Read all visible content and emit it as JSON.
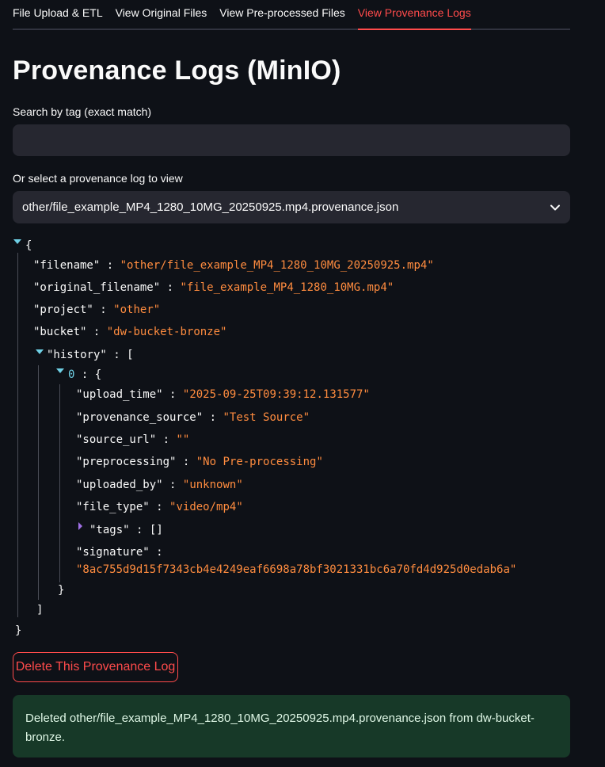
{
  "tabs": [
    {
      "label": "File Upload & ETL"
    },
    {
      "label": "View Original Files"
    },
    {
      "label": "View Pre-processed Files"
    },
    {
      "label": "View Provenance Logs"
    }
  ],
  "active_tab": "View Provenance Logs",
  "page_title": "Provenance Logs (MinIO)",
  "search": {
    "label": "Search by tag (exact match)",
    "value": "",
    "placeholder": ""
  },
  "select": {
    "label": "Or select a provenance log to view",
    "value": "other/file_example_MP4_1280_10MG_20250925.mp4.provenance.json"
  },
  "json_view": {
    "open_brace": "{",
    "close_brace": "}",
    "filename_key": "\"filename\"",
    "filename_val": "\"other/file_example_MP4_1280_10MG_20250925.mp4\"",
    "original_filename_key": "\"original_filename\"",
    "original_filename_val": "\"file_example_MP4_1280_10MG.mp4\"",
    "project_key": "\"project\"",
    "project_val": "\"other\"",
    "bucket_key": "\"bucket\"",
    "bucket_val": "\"dw-bucket-bronze\"",
    "history_key": "\"history\"",
    "open_bracket": "[",
    "close_bracket": "]",
    "index_0": "0",
    "colon": ":",
    "upload_time_key": "\"upload_time\"",
    "upload_time_val": "\"2025-09-25T09:39:12.131577\"",
    "provenance_source_key": "\"provenance_source\"",
    "provenance_source_val": "\"Test Source\"",
    "source_url_key": "\"source_url\"",
    "source_url_val": "\"\"",
    "preprocessing_key": "\"preprocessing\"",
    "preprocessing_val": "\"No Pre-processing\"",
    "uploaded_by_key": "\"uploaded_by\"",
    "uploaded_by_val": "\"unknown\"",
    "file_type_key": "\"file_type\"",
    "file_type_val": "\"video/mp4\"",
    "tags_key": "\"tags\"",
    "tags_val": "[]",
    "signature_key": "\"signature\"",
    "signature_val": "\"8ac755d9d15f7343cb4e4249eaf6698a78bf3021331bc6a70fd4d925d0edab6a\""
  },
  "delete_button": "Delete This Provenance Log",
  "alert": {
    "line1": "Deleted other/file_example_MP4_1280_10MG_20250925.mp4.provenance.json from dw-bucket-",
    "line2": "bronze."
  },
  "colors": {
    "accent": "#ff4b4b",
    "json_value": "#ff8c3f",
    "json_index": "#6fd0e5",
    "success_bg": "#173928"
  }
}
